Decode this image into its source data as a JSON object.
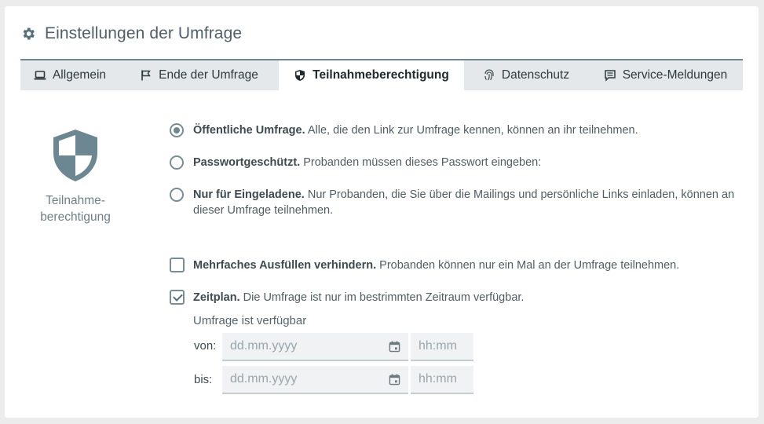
{
  "header": {
    "title": "Einstellungen der Umfrage",
    "icon": "gear-icon"
  },
  "tabs": [
    {
      "label": "Allgemein",
      "icon": "laptop-icon",
      "active": false
    },
    {
      "label": "Ende der Umfrage",
      "icon": "flag-icon",
      "active": false
    },
    {
      "label": "Teilnahmeberechtigung",
      "icon": "shield-icon",
      "active": true
    },
    {
      "label": "Datenschutz",
      "icon": "fingerprint-icon",
      "active": false
    },
    {
      "label": "Service-Meldungen",
      "icon": "message-icon",
      "active": false
    }
  ],
  "side": {
    "label_line1": "Teilnahme-",
    "label_line2": "berechtigung",
    "icon": "shield-icon"
  },
  "options": {
    "public": {
      "title": "Öffentliche Umfrage.",
      "desc": "Alle, die den Link zur Umfrage kennen, können an ihr teilnehmen.",
      "selected": true
    },
    "password": {
      "title": "Passwortgeschützt.",
      "desc": "Probanden müssen dieses Passwort eingeben:",
      "selected": false
    },
    "invited": {
      "title": "Nur für Eingeladene.",
      "desc_line1": "Nur Probanden, die Sie über die Mailings und persönliche Links einladen, können an",
      "desc_line2": "dieser Umfrage teilnehmen.",
      "selected": false
    }
  },
  "checkboxes": {
    "multiple": {
      "title": "Mehrfaches Ausfüllen verhindern.",
      "desc": "Probanden können nur ein Mal an der Umfrage teilnehmen.",
      "checked": false
    },
    "schedule": {
      "title": "Zeitplan.",
      "desc": "Die Umfrage ist nur im bestrimmten Zeitraum verfügbar.",
      "checked": true
    }
  },
  "schedule": {
    "available_label": "Umfrage ist verfügbar",
    "from_label": "von:",
    "to_label": "bis:",
    "date_placeholder": "dd.mm.yyyy",
    "time_placeholder": "hh:mm"
  },
  "colors": {
    "accent": "#6d8792",
    "tab_bar": "#e4e8ea",
    "icon": "#5f7680"
  }
}
